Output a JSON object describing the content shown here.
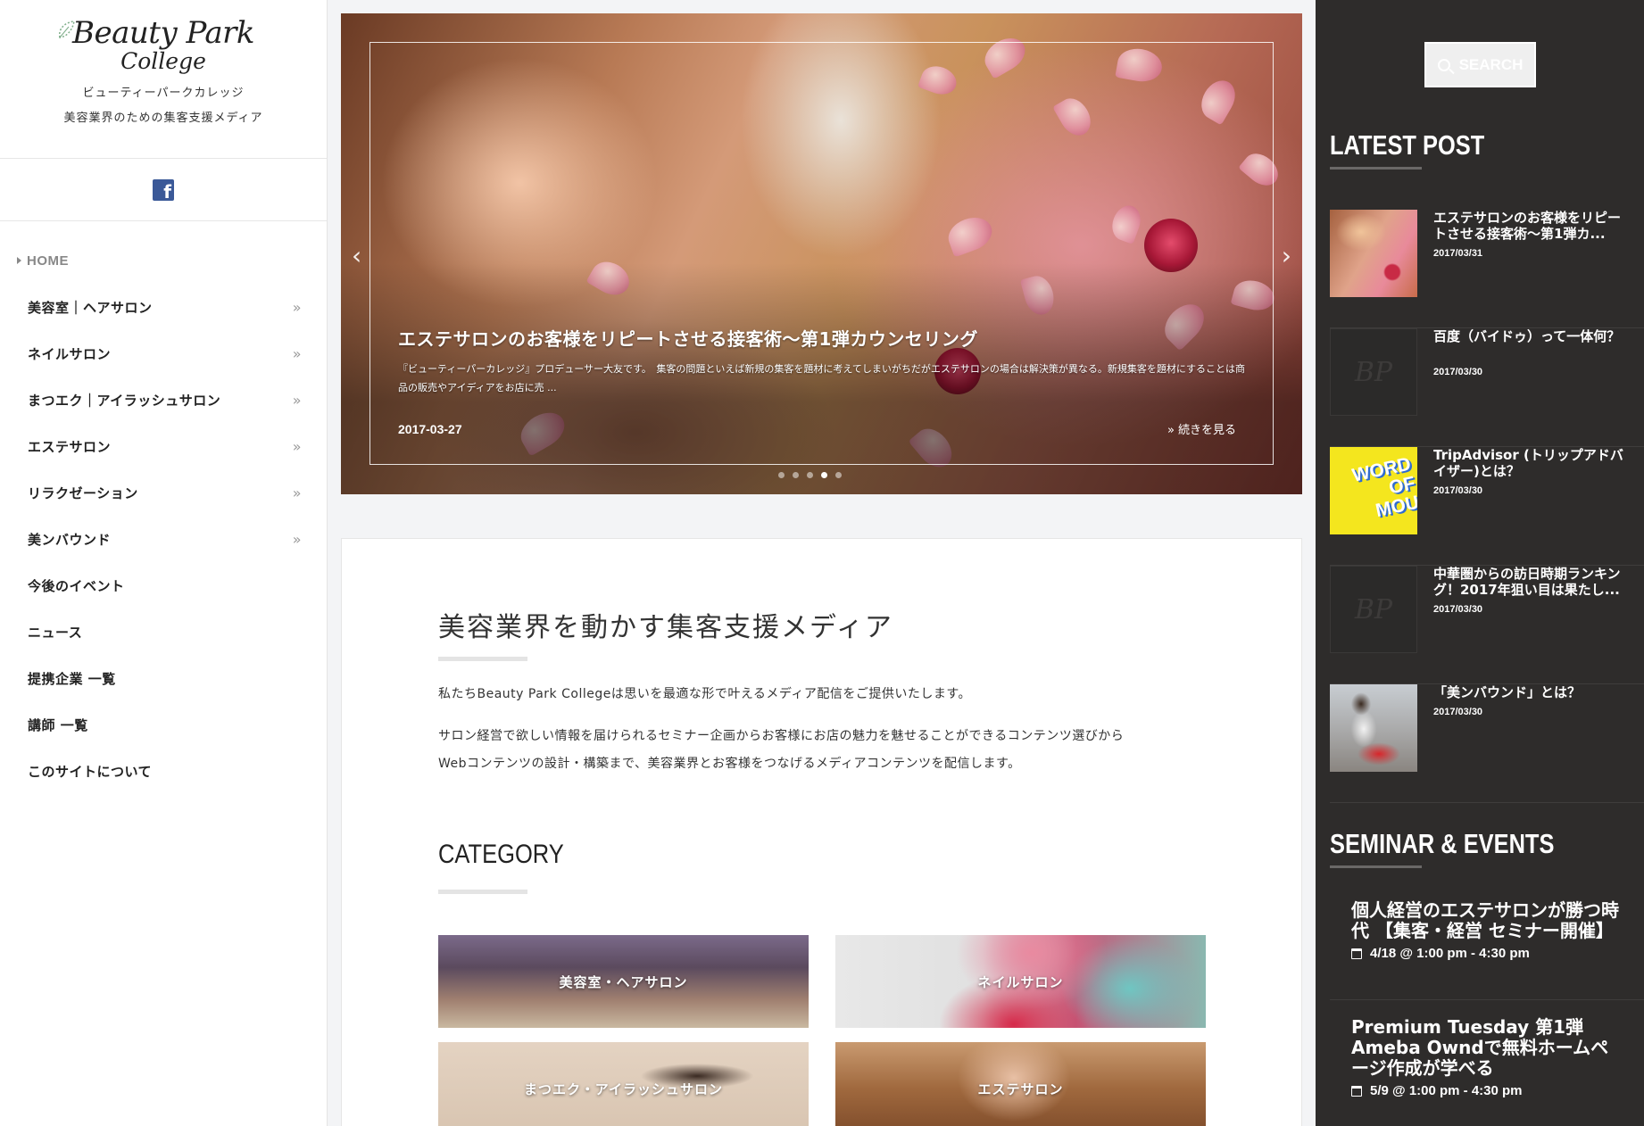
{
  "site": {
    "logo_line1": "Beauty Park",
    "logo_line2": "College",
    "tagline_kana": "ビューティーパークカレッジ",
    "tagline": "美容業界のための集客支援メディア"
  },
  "social": {
    "facebook_icon": "facebook-icon",
    "facebook_color": "#3b5998"
  },
  "nav": {
    "items": [
      {
        "label": "HOME",
        "arrow": ""
      },
      {
        "label": "美容室｜ヘアサロン",
        "arrow": "»"
      },
      {
        "label": "ネイルサロン",
        "arrow": "»"
      },
      {
        "label": "まつエク｜アイラッシュサロン",
        "arrow": "»"
      },
      {
        "label": "エステサロン",
        "arrow": "»"
      },
      {
        "label": "リラクゼーション",
        "arrow": "»"
      },
      {
        "label": "美ンバウンド",
        "arrow": "»"
      },
      {
        "label": "今後のイベント",
        "arrow": ""
      },
      {
        "label": "ニュース",
        "arrow": ""
      },
      {
        "label": "提携企業 一覧",
        "arrow": ""
      },
      {
        "label": "講師 一覧",
        "arrow": ""
      },
      {
        "label": "このサイトについて",
        "arrow": ""
      }
    ]
  },
  "slider": {
    "title": "エステサロンのお客様をリピートさせる接客術〜第1弾カウンセリング",
    "excerpt": "『ビューティーパーカレッジ』プロデューサー大友です。　集客の問題といえば新規の集客を題材に考えてしまいがちだがエステサロンの場合は解決策が異なる。新規集客を題材にすることは商品の販売やアイディアをお店に売 ...",
    "date": "2017-03-27",
    "more_label": "続きを見る",
    "prev_icon": "‹",
    "next_icon": "›",
    "dots_total": 5,
    "dots_active": 4
  },
  "intro": {
    "headline": "美容業界を動かす集客支援メディア",
    "para1": "私たちBeauty Park Collegeは思いを最適な形で叶えるメディア配信をご提供いたします。",
    "para2a": "サロン経営で欲しい情報を届けられるセミナー企画からお客様にお店の魅力を魅せることができるコンテンツ選びから",
    "para2b": "Webコンテンツの設計・構築まで、美容業界とお客様をつなげるメディアコンテンツを配信します。"
  },
  "category": {
    "title": "CATEGORY",
    "items": [
      {
        "label": "美容室・ヘアサロン"
      },
      {
        "label": "ネイルサロン"
      },
      {
        "label": "まつエク・アイラッシュサロン"
      },
      {
        "label": "エステサロン"
      }
    ]
  },
  "right": {
    "search_label": "SEARCH",
    "latest_title": "LATEST POST",
    "posts": [
      {
        "title": "エステサロンのお客様をリピートさせる接客術〜第1弾カ...",
        "date": "2017/03/31"
      },
      {
        "title": "百度（バイドゥ）って一体何？",
        "date": "2017/03/30"
      },
      {
        "title": "TripAdvisor (トリップアドバイザー)とは？",
        "date": "2017/03/30",
        "thumb_text": "WORD OF MOU"
      },
      {
        "title": "中華圏からの訪日時期ランキング！2017年狙い目は果たし...",
        "date": "2017/03/30"
      },
      {
        "title": "「美ンバウンド」とは？",
        "date": "2017/03/30"
      }
    ],
    "events_title": "SEMINAR & EVENTS",
    "events": [
      {
        "title": "個人経営のエステサロンが勝つ時代 【集客・経営 セミナー開催】",
        "time": "4/18 @ 1:00 pm - 4:30 pm"
      },
      {
        "title": "Premium Tuesday 第1弾 Ameba Owndで無料ホームページ作成が学べる",
        "time": "5/9 @ 1:00 pm - 4:30 pm"
      }
    ]
  }
}
